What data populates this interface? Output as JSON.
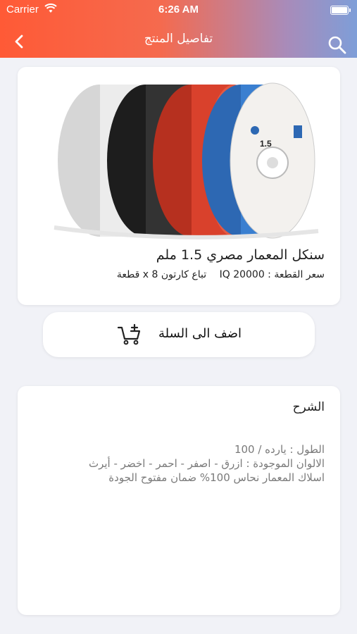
{
  "status_bar": {
    "carrier": "Carrier",
    "time": "6:26 AM"
  },
  "nav": {
    "title": "تفاصيل المنتج",
    "back_icon": "chevron-left-icon",
    "search_icon": "search-icon"
  },
  "product": {
    "name": "سنكل المعمار مصري 1.5 ملم",
    "price_label": "سعر القطعة : IQ 20000",
    "pack_label": "تباع كارتون x 8 قطعة",
    "spool_colors": [
      "#e9e9e9",
      "#2a2a2a",
      "#d9412c",
      "#3a7fd0"
    ]
  },
  "cart": {
    "label": "اضف الى السلة",
    "icon": "cart-add-icon"
  },
  "description": {
    "title": "الشرح",
    "lines": [
      "الطول : يارده / 100",
      "الالوان الموجودة : ازرق - اصفر - احمر - اخضر - أيرث",
      "اسلاك المعمار نحاس 100% ضمان مفتوح الجودة"
    ]
  },
  "colors": {
    "gradient_start": "#ff5a36",
    "gradient_end": "#7e9ed8",
    "background": "#f1f2f7"
  }
}
